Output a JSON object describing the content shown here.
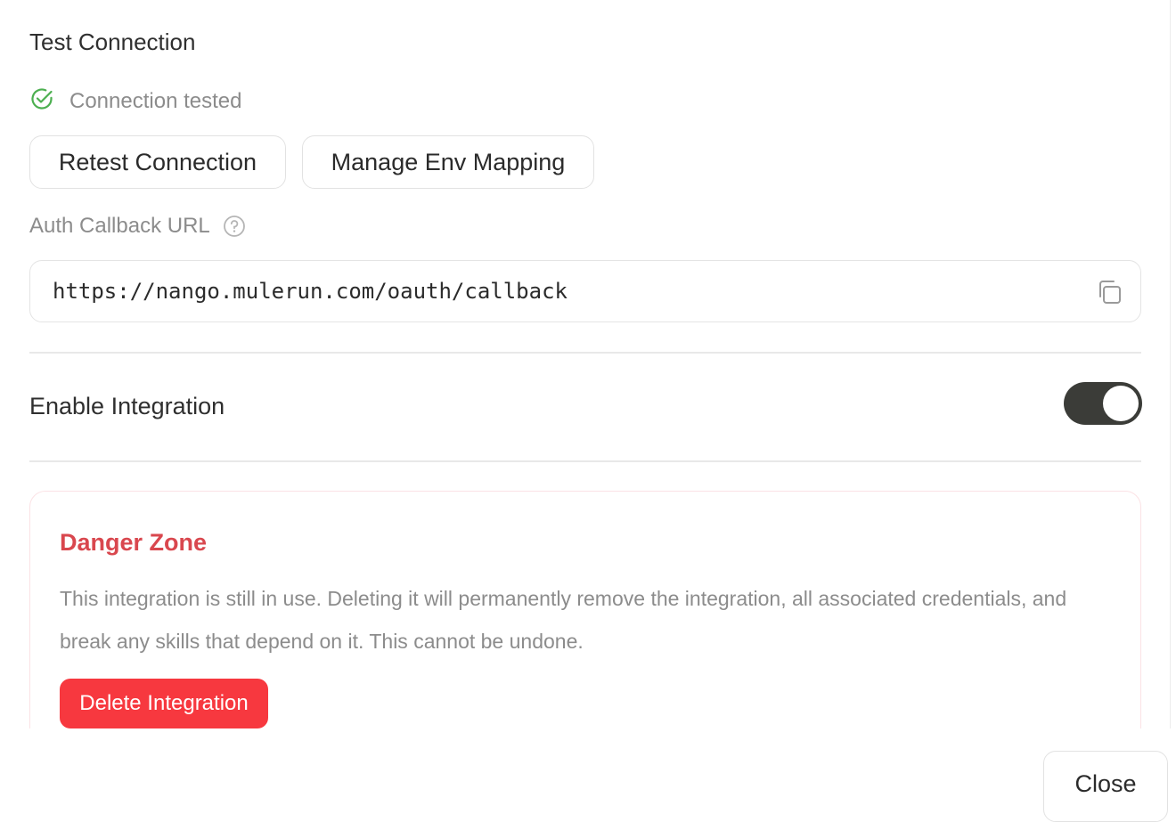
{
  "test_connection": {
    "title": "Test Connection",
    "status_text": "Connection tested",
    "status_color": "#4caf50",
    "status_icon": "check-circle-icon",
    "retest_label": "Retest Connection",
    "env_mapping_label": "Manage Env Mapping"
  },
  "auth_callback": {
    "label": "Auth Callback URL",
    "help_icon": "question-circle-icon",
    "url": "https://nango.mulerun.com/oauth/callback",
    "copy_icon": "copy-icon"
  },
  "integration": {
    "enable_label": "Enable Integration",
    "enabled": true
  },
  "danger_zone": {
    "title": "Danger Zone",
    "description": "This integration is still in use. Deleting it will permanently remove the integration, all associated credentials, and break any skills that depend on it. This cannot be undone.",
    "delete_label": "Delete Integration",
    "accent_color": "#f7383f"
  },
  "footer": {
    "close_label": "Close"
  }
}
